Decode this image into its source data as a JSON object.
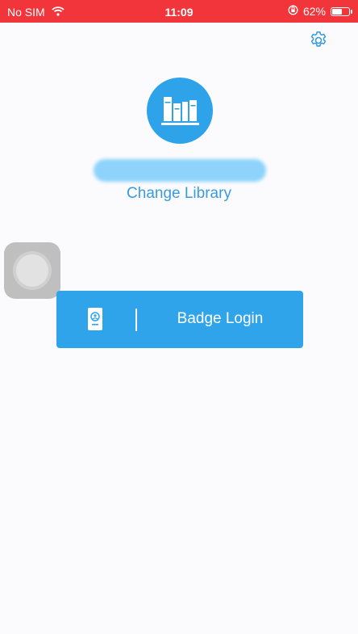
{
  "status_bar": {
    "carrier": "No SIM",
    "time": "11:09",
    "battery_text": "62%",
    "battery_level": 0.62,
    "background_color": "#f2353b",
    "icons": [
      "wifi-icon",
      "orientation-lock-icon",
      "battery-icon"
    ]
  },
  "header": {
    "settings_icon": "gear-icon",
    "logo_icon": "books-icon"
  },
  "library": {
    "change_label": "Change Library"
  },
  "login": {
    "badge_label": "Badge Login",
    "badge_icon": "badge-card-icon",
    "accent_color": "#30a4ea"
  },
  "colors": {
    "accent": "#2ea3ea",
    "link": "#3a9bdc",
    "background": "#fbfbfd"
  }
}
